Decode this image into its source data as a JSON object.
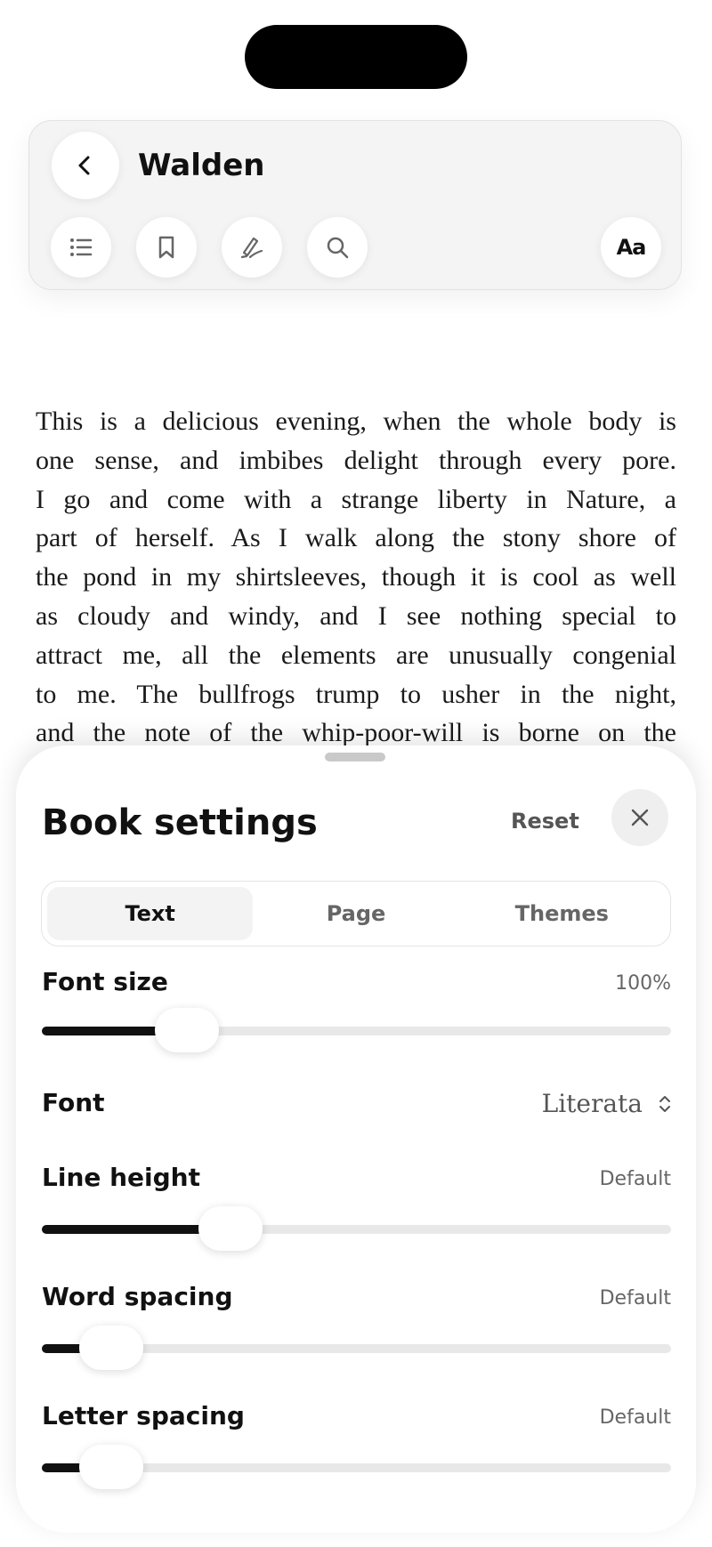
{
  "header": {
    "book_title": "Walden",
    "icons": [
      "chevron-left-icon",
      "list-icon",
      "bookmark-icon",
      "highlighter-icon",
      "search-icon"
    ],
    "text_settings_label": "Aa"
  },
  "reading": {
    "lines": [
      "This is a delicious evening, when the whole body is",
      "one sense, and imbibes delight through every pore.",
      "I go and come with a strange liberty in Nature, a",
      "part of herself. As I walk along the stony shore of",
      "the pond in my shirtsleeves, though it is cool as well",
      "as cloudy and windy, and I see nothing special to",
      "attract me, all the elements are unusually congenial",
      "to me. The bullfrogs trump to usher in the night,",
      "and the note of the whip-poor-will is borne on the"
    ]
  },
  "sheet": {
    "title": "Book settings",
    "reset_label": "Reset",
    "tabs": [
      {
        "label": "Text",
        "active": true
      },
      {
        "label": "Page",
        "active": false
      },
      {
        "label": "Themes",
        "active": false
      }
    ],
    "font_size": {
      "label": "Font size",
      "value": "100%",
      "level": 0.23
    },
    "font": {
      "label": "Font",
      "value": "Literata"
    },
    "line_height": {
      "label": "Line height",
      "value": "Default",
      "level": 0.3
    },
    "word_spacing": {
      "label": "Word spacing",
      "value": "Default",
      "level": 0.11
    },
    "letter_spacing": {
      "label": "Letter spacing",
      "value": "Default",
      "level": 0.11
    }
  }
}
